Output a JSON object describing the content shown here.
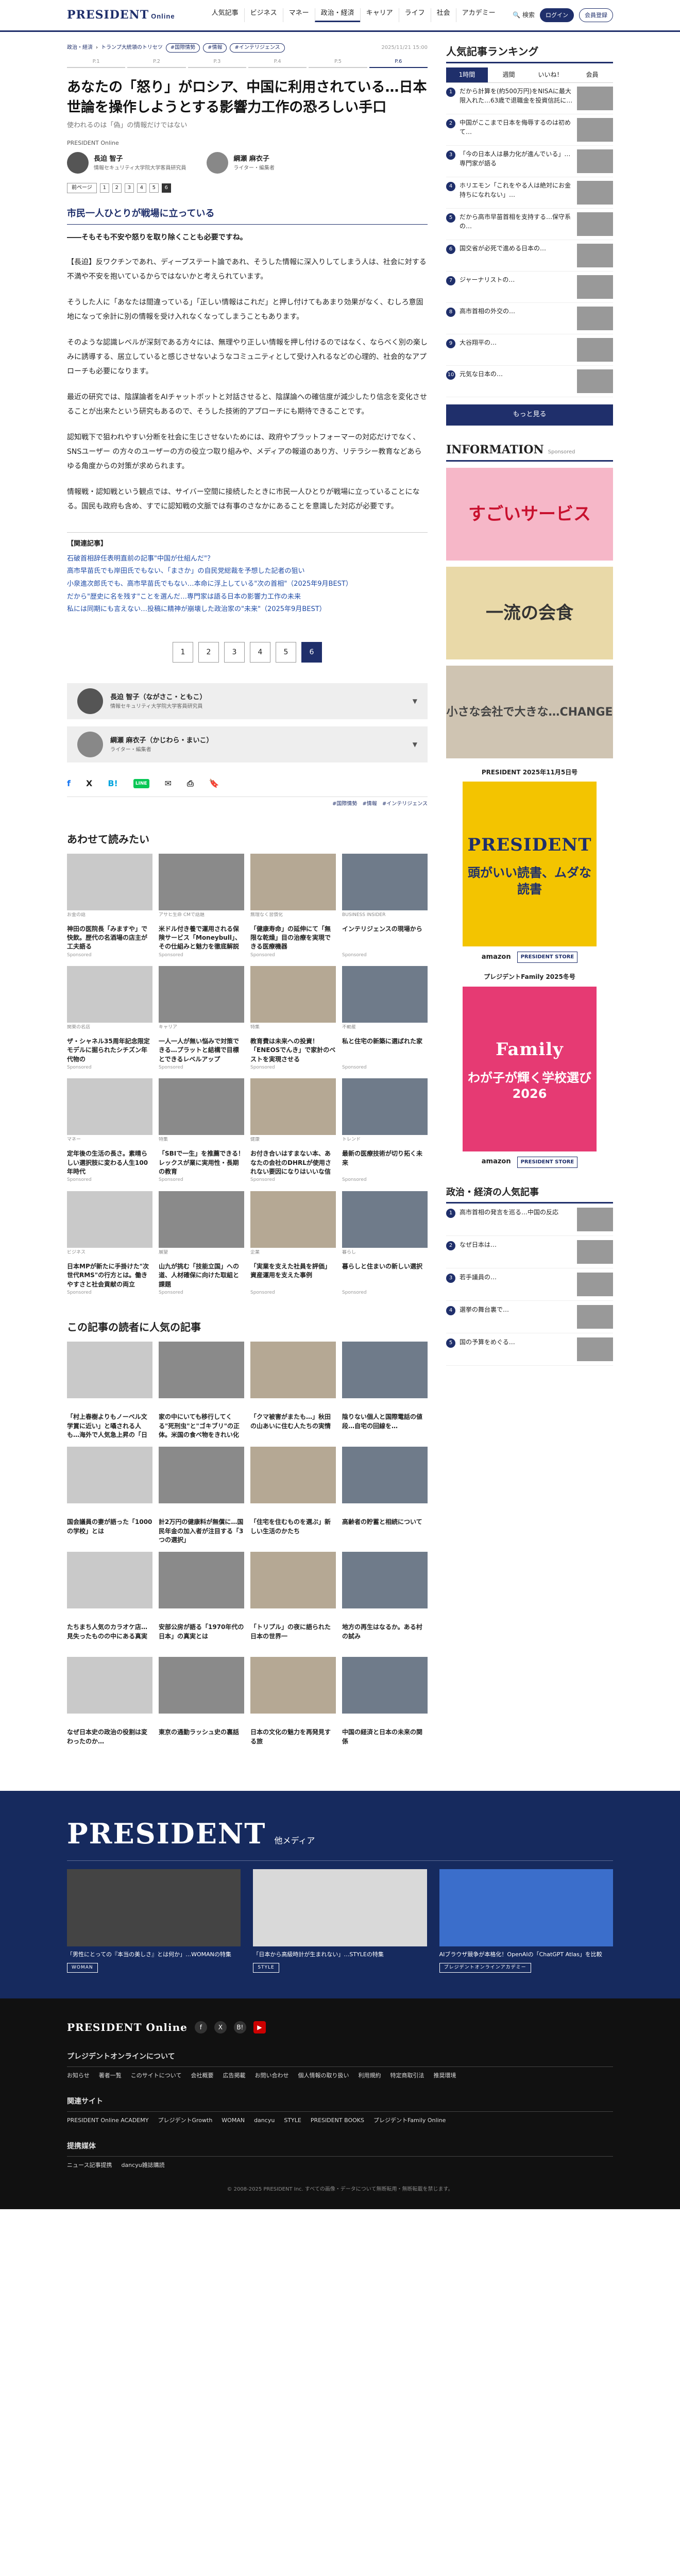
{
  "header": {
    "logo": "PRESIDENT",
    "logo_sub": "Online",
    "nav": [
      "人気記事",
      "ビジネス",
      "マネー",
      "政治・経済",
      "キャリア",
      "ライフ",
      "社会",
      "アカデミー"
    ],
    "active_nav": "政治・経済",
    "search": "検索",
    "login": "ログイン",
    "register": "会員登録"
  },
  "article": {
    "crumb1": "政治・経済",
    "crumb2": "トランプ大統領のトリセツ",
    "tags": [
      "#国際情勢",
      "#情報",
      "#インテリジェンス"
    ],
    "date": "2025/11/21 15:00",
    "pages": [
      "P.1",
      "P.2",
      "P.3",
      "P.4",
      "P.5",
      "P.6"
    ],
    "title": "あなたの「怒り」がロシア、中国に利用されている…日本世論を操作しようとする影響力工作の恐ろしい手口",
    "subtitle": "使われるのは「偽」の情報だけではない",
    "brand": "PRESIDENT Online",
    "authors": [
      {
        "name": "長迫 智子",
        "role": "情報セキュリティ大学院大学客員研究員"
      },
      {
        "name": "綱瀬 麻衣子",
        "role": "ライター・編集者"
      }
    ],
    "prev": "前ページ",
    "page_nums": [
      "1",
      "2",
      "3",
      "4",
      "5",
      "6"
    ],
    "section": "市民一人ひとりが戦場に立っている",
    "lead": "――そもそも不安や怒りを取り除くことも必要ですね。",
    "paragraphs": [
      "【長迫】反ワクチンであれ、ディープステート論であれ、そうした情報に深入りしてしまう人は、社会に対する不満や不安を抱いているからではないかと考えられています。",
      "そうした人に「あなたは間違っている」「正しい情報はこれだ」と押し付けてもあまり効果がなく、むしろ意固地になって余計に別の情報を受け入れなくなってしまうこともあります。",
      "そのような認識レベルが深刻である方々には、無理やり正しい情報を押し付けるのではなく、ならべく別の楽しみに誘導する、居立していると感じさせないようなコミュニティとして受け入れるなどの心理的、社会的なアプローチも必要になります。",
      "最近の研究では、陰謀論者をAIチャットボットと対話させると、陰謀論への確信度が減少したり信念を変化させることが出来たという研究もあるので、そうした技術的アプローチにも期待できることです。",
      "認知戦下で狙われやすい分断を社会に生じさせないためには、政府やプラットフォーマーの対応だけでなく、SNSユーザー の方々のユーザーの方の役立つ取り組みや、メディアの報道のあり方、リテラシー教育などあらゆる角度からの対策が求められます。",
      "情報戦・認知戦という観点では、サイバー空間に接続したときに市民一人ひとりが戦場に立っていることになる。国民も政府も含め、すでに認知戦の文脈では有事のさなかにあることを意識した対応が必要です。"
    ],
    "related_title": "【関連記事】",
    "related": [
      "石破首相辞任表明直前の記事\"中国が仕組んだ\"？",
      "高市早苗氏でも岸田氏でもない、「まさか」の自民党総裁を予想した記者の狙い",
      "小泉進次郎氏でも、高市早苗氏でもない…本命に浮上している\"次の首相\"（2025年9月BEST）",
      "だから\"歴史に名を残す\"ことを選んだ…専門家は語る日本の影響力工作の未来",
      "私には同期にも言えない…投稿に精神が崩壊した政治家の\"未来\"（2025年9月BEST）"
    ],
    "pager": [
      "1",
      "2",
      "3",
      "4",
      "5",
      "6"
    ],
    "author_boxes": [
      {
        "name": "長迫 智子（ながさこ・ともこ）",
        "role": "情報セキュリティ大学院大学客員研究員"
      },
      {
        "name": "綱瀬 麻衣子（かじわら・まいこ）",
        "role": "ライター・編集者"
      }
    ],
    "share": [
      "f",
      "X",
      "B!",
      "LINE",
      "✉",
      "⎙",
      "🔖"
    ],
    "tags_bottom": [
      "#国際情勢",
      "#情報",
      "#インテリジェンス"
    ]
  },
  "recommend": {
    "title": "あわせて読みたい",
    "cards": [
      {
        "k": "お金の話",
        "t": "神田の医院長「みますや」で快飲。歴代の名酒場の店主が工夫語る",
        "sp": "Sponsored"
      },
      {
        "k": "アサヒ生命 CMで話題",
        "t": "米ドル付き養で運用される保険サービス「Moneybull」、その仕組みと魅力を徹底解説",
        "sp": "Sponsored"
      },
      {
        "k": "無理なく習慣化",
        "t": "「健康寿命」の延伸にて「無限な乾燥」目の治療を実現できる医療機器",
        "sp": "Sponsored"
      },
      {
        "k": "BUSINESS INSIDER",
        "t": "インテリジェンスの現場から",
        "sp": "Sponsored"
      },
      {
        "k": "関東の名店",
        "t": "ザ・シャネル35周年記念限定モデルに掘られたシチズン年代物の",
        "sp": "Sponsored"
      },
      {
        "k": "キャリア",
        "t": "一人一人が無い悩みで対策できる…プラットと結構で目標とできるレベルアップ",
        "sp": "Sponsored"
      },
      {
        "k": "特集",
        "t": "教育費は未来への投資！「ENEOSでんき」で家計のベストを実現させる",
        "sp": "Sponsored"
      },
      {
        "k": "不動産",
        "t": "私と住宅の新築に選ばれた家",
        "sp": "Sponsored"
      },
      {
        "k": "マネー",
        "t": "定年後の生活の長さ。素晴らしい選択肢に変わる人生100年時代",
        "sp": "Sponsored"
      },
      {
        "k": "特集",
        "t": "「SBIで一生」を推薦できる！レックスが業に実用性・長期の教育",
        "sp": "Sponsored"
      },
      {
        "k": "健康",
        "t": "お付き合いはすまない本、あなたの会社のDHRLが使用されない要因になりはいいな信頼",
        "sp": "Sponsored"
      },
      {
        "k": "トレンド",
        "t": "最新の医療技術が切り拓く未来",
        "sp": "Sponsored"
      },
      {
        "k": "ビジネス",
        "t": "日本MPが新たに手掛けた\"次世代RMS\"の行方とは。働きやすさと社会貢献の両立",
        "sp": "Sponsored"
      },
      {
        "k": "展望",
        "t": "山九が挑む「技能立国」への道、人材確保に向けた取組と課題",
        "sp": "Sponsored"
      },
      {
        "k": "企業",
        "t": "「実業を支えた社員を評価」資産運用を支えた事例",
        "sp": "Sponsored"
      },
      {
        "k": "暮らし",
        "t": "暮らしと住まいの新しい選択",
        "sp": "Sponsored"
      }
    ]
  },
  "popular": {
    "title": "この記事の読者に人気の記事",
    "cards": [
      {
        "k": "",
        "t": "「村上春樹よりもノーベル文学賞に近い」と囁される人も…海外で人気急上昇の「日本人女性作家」の名前",
        "sp": ""
      },
      {
        "k": "",
        "t": "家の中にいても移行してくる\"死刑虫\"と\"ゴキブリ\"の正体。米国の食べ物をきれい化するタイプ",
        "sp": ""
      },
      {
        "k": "",
        "t": "「クマ被害がまたも…」秋田の山あいに住む人たちの実情",
        "sp": ""
      },
      {
        "k": "",
        "t": "陰りない個人と国際電話の値段…自宅の回線を…",
        "sp": ""
      },
      {
        "k": "",
        "t": "国会議員の妻が語った「1000の学校」とは",
        "sp": ""
      },
      {
        "k": "",
        "t": "計2万円の健康料が無償に…国民年金の加入者が注目する「3つの選択」",
        "sp": ""
      },
      {
        "k": "",
        "t": "「住宅を住むものを選ぶ」新しい生活のかたち",
        "sp": ""
      },
      {
        "k": "",
        "t": "高齢者の貯蓄と相続について",
        "sp": ""
      },
      {
        "k": "",
        "t": "たちまち人気のカラオケ店…見失ったものの中にある真実",
        "sp": ""
      },
      {
        "k": "",
        "t": "安部公房が語る「1970年代の日本」の真実とは",
        "sp": ""
      },
      {
        "k": "",
        "t": "「トリプル」の夜に語られた日本の世界一",
        "sp": ""
      },
      {
        "k": "",
        "t": "地方の再生はなるか。ある村の試み",
        "sp": ""
      },
      {
        "k": "",
        "t": "なぜ日本史の政治の役割は変わったのか…",
        "sp": ""
      },
      {
        "k": "",
        "t": "東京の通勤ラッシュ史の裏話",
        "sp": ""
      },
      {
        "k": "",
        "t": "日本の文化の魅力を再発見する旅",
        "sp": ""
      },
      {
        "k": "",
        "t": "中国の経済と日本の未来の関係",
        "sp": ""
      }
    ]
  },
  "ranking": {
    "title": "人気記事ランキング",
    "tabs": [
      "1時間",
      "週間",
      "いいね！",
      "会員"
    ],
    "items": [
      "だから計算を(約500万円)をNISAに最大限入れた…63歳で退職金を投資信託に…",
      "中国がここまで日本を侮辱するのは初めて…",
      "「今の日本人は暴力化が進んでいる」…専門家が語る",
      "ホリエモン「これをやる人は絶対にお金持ちになれない」…",
      "だから高市早苗首相を支持する…保守系の…",
      "国交省が必死で進める日本の…",
      "ジャーナリストの…",
      "高市首相の外交の…",
      "大谷翔平の…",
      "元気な日本の…"
    ],
    "more": "もっと見る"
  },
  "info": {
    "title": "INFORMATION",
    "sp": "Sponsored",
    "b1": "すごいサービス",
    "b2": "一流の会食",
    "b3": "小さな会社で大きな…CHANGE"
  },
  "magazine1": {
    "caption": "PRESIDENT 2025年11月5日号",
    "name": "PRESIDENT",
    "headline": "頭がいい読書、ムダな読書",
    "amazon": "amazon",
    "store": "PRESIDENT STORE"
  },
  "magazine2": {
    "caption": "プレジデントFamily 2025冬号",
    "name": "Family",
    "headline": "わが子が輝く学校選び2026",
    "amazon": "amazon",
    "store": "PRESIDENT STORE"
  },
  "politics_rank": {
    "title": "政治・経済の人気記事",
    "items": [
      "高市首相の発言を巡る…中国の反応",
      "なぜ日本は…",
      "若手議員の…",
      "選挙の舞台裏で…",
      "国の予算をめぐる…"
    ]
  },
  "media": {
    "title": "PRESIDENT",
    "sub": "他メディア",
    "items": [
      {
        "t": "「男性にとっての『本当の美しさ』とは何か」…WOMANの特集",
        "lab": "WOMAN"
      },
      {
        "t": "「日本から高級時計が生まれない」…STYLEの特集",
        "lab": "STYLE"
      },
      {
        "t": "AIブラウザ競争が本格化！OpenAIの「ChatGPT Atlas」を比較",
        "lab": "プレジデントオンラインアカデミー"
      }
    ]
  },
  "footer": {
    "logo": "PRESIDENT Online",
    "social": [
      "f",
      "X",
      "B!",
      "▶"
    ],
    "about": "プレジデントオンラインについて",
    "links1": [
      "お知らせ",
      "著者一覧",
      "このサイトについて",
      "会社概要",
      "広告掲載",
      "お問い合わせ",
      "個人情報の取り扱い",
      "利用規約",
      "特定商取引法",
      "推奨環境"
    ],
    "related": "関連サイト",
    "links2": [
      "PRESIDENT Online ACADEMY",
      "プレジデントGrowth",
      "WOMAN",
      "dancyu",
      "STYLE",
      "PRESIDENT BOOKS",
      "プレジデントFamily Online"
    ],
    "partners": "提携媒体",
    "links3": [
      "ニュース記事提携",
      "dancyu雑誌購読"
    ],
    "copy": "© 2008-2025 PRESIDENT Inc. すべての画像・データについて無断転用・無断転載を禁じます。"
  }
}
